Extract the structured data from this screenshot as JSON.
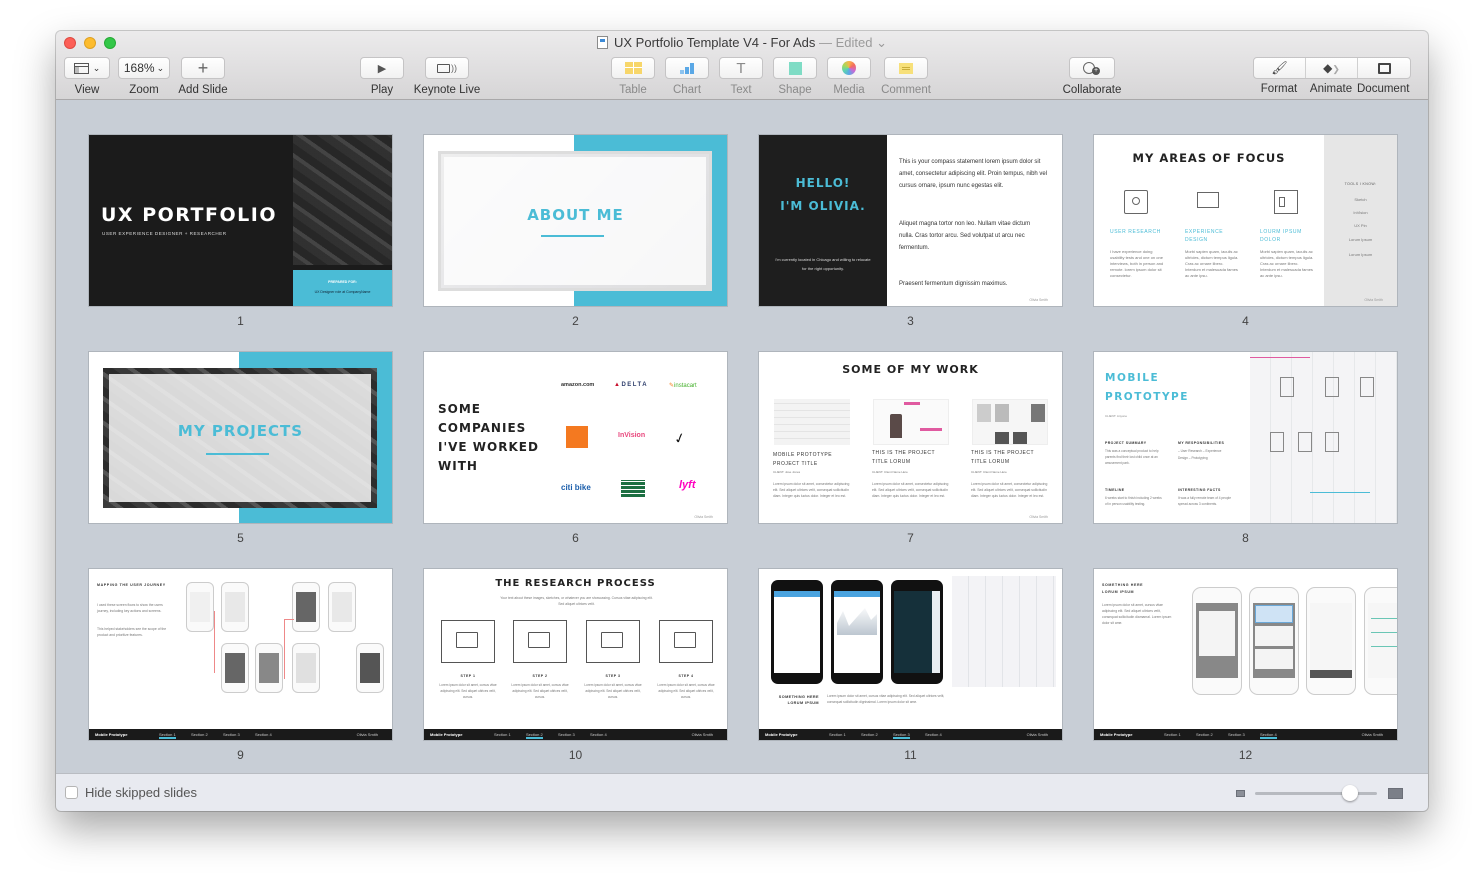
{
  "window": {
    "title": "UX Portfolio Template V4 - For Ads",
    "status": "— Edited",
    "status_chevron": "⌄"
  },
  "toolbar": {
    "view": {
      "label": "View",
      "icon": "sidebar-layout-icon"
    },
    "zoom": {
      "label": "Zoom",
      "value": "168%"
    },
    "add_slide": {
      "label": "Add Slide",
      "icon": "+"
    },
    "play": {
      "label": "Play",
      "icon": "▶"
    },
    "keynote_live": {
      "label": "Keynote Live",
      "icon": "broadcast-display-icon"
    },
    "table": {
      "label": "Table",
      "color": "#f7d66a"
    },
    "chart": {
      "label": "Chart",
      "color": "#5aa8e6"
    },
    "text": {
      "label": "Text",
      "icon": "T"
    },
    "shape": {
      "label": "Shape",
      "color": "#7fdcc5"
    },
    "media": {
      "label": "Media"
    },
    "comment": {
      "label": "Comment",
      "color": "#f7e07a"
    },
    "collaborate": {
      "label": "Collaborate"
    },
    "format": {
      "label": "Format"
    },
    "animate": {
      "label": "Animate"
    },
    "document": {
      "label": "Document"
    }
  },
  "colors": {
    "accent_teal": "#4bbcd6",
    "canvas_bg": "#c8ced6",
    "slide_dark": "#1b1b1b"
  },
  "slides": [
    {
      "number": "1",
      "title": "UX PORTFOLIO",
      "subtitle": "USER EXPERIENCE DESIGNER + RESEARCHER",
      "prepared_label": "PREPARED FOR:",
      "prepared_value": "UX Designer role at CompanyName"
    },
    {
      "number": "2",
      "title": "ABOUT ME"
    },
    {
      "number": "3",
      "heading_line1": "HELLO!",
      "heading_line2": "I'M OLIVIA.",
      "location": "I'm currently located in Chicago and willing to relocate for the right opportunity.",
      "para1": "This is your compass statement lorem ipsum dolor sit amet, consectetur adipiscing elit. Proin tempus, nibh vel cursus ornare, ipsum nunc egestas elit.",
      "para2": "Aliquet magna tortor non leo. Nullam vitae dictum nulla. Cras tortor arcu. Sed volutpat ut arcu nec fermentum.",
      "para3": "Praesent fermentum dignissim maximus.",
      "footer": "Olivia Smith"
    },
    {
      "number": "4",
      "title": "MY AREAS OF FOCUS",
      "areas": [
        {
          "title": "USER RESEARCH",
          "text": "I have experience doing usability tests and one on one interviews, both in person and remote. lorem ipsum dolor sit consectetur."
        },
        {
          "title": "EXPERIENCE DESIGN",
          "text": "Morbi sapien quam, iaculis ac ultricies, dictum tempus ligula. Cras ac ornare libero. Interdum et malesuada fames ac ante ipsu."
        },
        {
          "title": "LOURM IPSUM DOLOR",
          "text": "Morbi sapien quam, iaculis ac ultricies, dictum tempus ligula. Cras ac ornare libero. Interdum et malesuada fames ac ante ipsu."
        }
      ],
      "tools_heading": "TOOLS I KNOW:",
      "tools": [
        "Sketch",
        "InVision",
        "UX Pin",
        "Lorum Ipsum",
        "Lorum Ipsum"
      ],
      "footer": "Olivia Smith"
    },
    {
      "number": "5",
      "title": "MY PROJECTS"
    },
    {
      "number": "6",
      "title_lines": [
        "SOME",
        "COMPANIES",
        "I'VE WORKED",
        "WITH"
      ],
      "logos": [
        "amazon.com",
        "DELTA",
        "instacart",
        "THE HOME DEPOT",
        "InVision",
        "nike-swoosh",
        "citi bike",
        "WHOLE FOODS",
        "lyft"
      ],
      "footer": "Olivia Smith"
    },
    {
      "number": "7",
      "title": "SOME OF MY WORK",
      "projects": [
        {
          "title": "MOBILE PROTOTYPE PROJECT TITLE",
          "client": "CLIENT: Jose Jones"
        },
        {
          "title": "THIS IS THE PROJECT TITLE LORUM",
          "client": "CLIENT: Client Name Here"
        },
        {
          "title": "THIS IS THE PROJECT TITLE LORUM",
          "client": "CLIENT: Client Name Here"
        }
      ],
      "body": "Lorem ipsum dolor sit amet, consectetur adipiscing elit. Sed aliquet ultrices velit, consequat sollicitudin diam. Integer quis luctus dolor. Integer et leo est.",
      "footer": "Olivia Smith"
    },
    {
      "number": "8",
      "title_line1": "MOBILE",
      "title_line2": "PROTOTYPE",
      "client": "CLIENT: Anyone",
      "sections": [
        {
          "heading": "PROJECT SUMMARY",
          "text": "This was a conceptual product to help parents find their lost child once at an amusement park."
        },
        {
          "heading": "MY RESPONSIBILITIES",
          "text": "– User Research – Experience Design – Prototyping"
        },
        {
          "heading": "TIMELINE",
          "text": "6 weeks start to finish including 2 weeks of in person usability testing."
        },
        {
          "heading": "INTERESTING FACTS",
          "text": "It was a fully remote team of 4 people spread across 3 continents."
        }
      ]
    },
    {
      "number": "9",
      "heading": "MAPPING THE USER JOURNEY",
      "para1": "I used these screen flows to show the users journey, including key actions and screens.",
      "para2": "This helped stakeholders see the scope of the product and prioritize features."
    },
    {
      "number": "10",
      "title": "THE RESEARCH PROCESS",
      "intro": "Your text about these images, sketches, or whatever you are showcasing. Cursus vitae adipiscing elit. Sed aliquet ultrices velit.",
      "steps": [
        {
          "label": "STEP 1",
          "text": "Lorem ipsum dolor sit amet, cursus vitae adipiscing elit. Sed aliquet ultrices velit, cursus."
        },
        {
          "label": "STEP 2",
          "text": "Lorem ipsum dolor sit amet, cursus vitae adipiscing elit. Sed aliquet ultrices velit, cursus."
        },
        {
          "label": "STEP 3",
          "text": "Lorem ipsum dolor sit amet, cursus vitae adipiscing elit. Sed aliquet ultrices velit, cursus."
        },
        {
          "label": "STEP 4",
          "text": "Lorem ipsum dolor sit amet, cursus vitae adipiscing elit. Sed aliquet ultrices velit, cursus."
        }
      ]
    },
    {
      "number": "11",
      "caption_line1": "SOMETHING HERE",
      "caption_line2": "LORUM IPSUM",
      "text": "Lorem ipsum dolor sit amet, cursus vitae adipiscing elit. Sed aliquet ultrices velit, consequat sollicitudin dignissimal. Lorem ipsum dolor sit ame."
    },
    {
      "number": "12",
      "heading_line1": "SOMETHING HERE",
      "heading_line2": "LORUM IPSUM",
      "text": "Lorem ipsum dolor sit amet, cursus vitae adipiscing elit. Sed aliquet ultrices velit, consequat sollicitudin diamamal. Lorem ipsum dolor sit ame."
    }
  ],
  "section_bar": {
    "title": "Mobile Prototype",
    "sections": [
      "Section 1",
      "Section 2",
      "Section 3",
      "Section 4"
    ],
    "author": "Olivia Smith"
  },
  "footer": {
    "hide_skipped_label": "Hide skipped slides",
    "hide_skipped_checked": false,
    "thumbnail_size_fraction": 0.78
  }
}
